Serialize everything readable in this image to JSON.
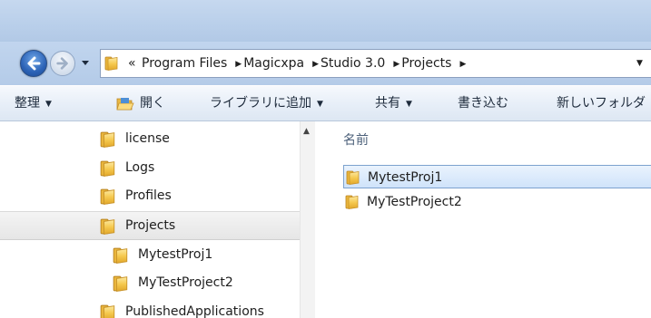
{
  "window": {
    "accent": "#2b62b6",
    "frame_color": "#b9cfea"
  },
  "navigation": {
    "back_icon": "back-arrow-icon",
    "forward_icon": "forward-arrow-icon",
    "history_icon": "chevron-down-icon"
  },
  "address_bar": {
    "overflow": "«",
    "crumbs": [
      "Program Files",
      "Magicxpa",
      "Studio 3.0",
      "Projects"
    ],
    "separator": "▶",
    "dropdown": "▼"
  },
  "toolbar": {
    "organize": "整理",
    "open": "開く",
    "library": "ライブラリに追加",
    "share": "共有",
    "burn": "書き込む",
    "new_folder": "新しいフォルダ",
    "caret": "▼"
  },
  "nav_pane": {
    "items": [
      {
        "label": "license"
      },
      {
        "label": "Logs"
      },
      {
        "label": "Profiles"
      },
      {
        "label": "Projects",
        "selected": true
      },
      {
        "label": "MytestProj1"
      },
      {
        "label": "MyTestProject2"
      },
      {
        "label": "PublishedApplications"
      }
    ],
    "scroll_up": "▲"
  },
  "content": {
    "column_name": "名前",
    "sort_indicator": "^",
    "files": [
      {
        "name": "MytestProj1",
        "selected": true
      },
      {
        "name": "MyTestProject2"
      }
    ]
  }
}
